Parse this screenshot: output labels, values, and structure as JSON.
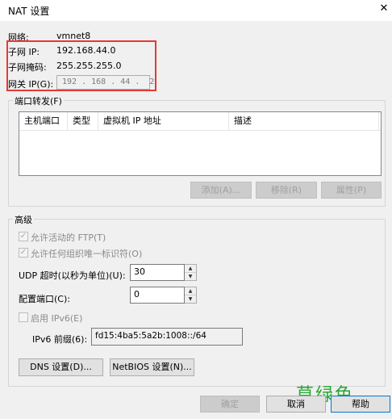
{
  "window": {
    "title": "NAT 设置",
    "close_glyph": "✕"
  },
  "network": {
    "network_label": "网络:",
    "network_value": "vmnet8",
    "subnet_ip_label": "子网 IP:",
    "subnet_ip_value": "192.168.44.0",
    "subnet_mask_label": "子网掩码:",
    "subnet_mask_value": "255.255.255.0",
    "gateway_label": "网关 IP(G):",
    "gateway_value": "192 . 168 . 44 .  2"
  },
  "port_forwarding": {
    "title": "端口转发(F)",
    "columns": [
      "主机端口",
      "类型",
      "虚拟机 IP 地址",
      "描述"
    ],
    "rows": [],
    "add_label": "添加(A)...",
    "remove_label": "移除(R)",
    "properties_label": "属性(P)"
  },
  "advanced": {
    "title": "高级",
    "allow_ftp_label": "允许活动的 FTP(T)",
    "allow_ftp_checked": true,
    "allow_oui_label": "允许任何组织唯一标识符(O)",
    "allow_oui_checked": true,
    "udp_timeout_label": "UDP 超时(以秒为单位)(U):",
    "udp_timeout_value": "30",
    "config_port_label": "配置端口(C):",
    "config_port_value": "0",
    "enable_ipv6_label": "启用 IPv6(E)",
    "enable_ipv6_checked": false,
    "ipv6_prefix_label": "IPv6 前缀(6):",
    "ipv6_prefix_value": "fd15:4ba5:5a2b:1008::/64",
    "dns_button_label": "DNS 设置(D)...",
    "netbios_button_label": "NetBIOS 设置(N)..."
  },
  "footer": {
    "ok_label": "确定",
    "cancel_label": "取消",
    "help_label": "帮助"
  },
  "watermark": {
    "text": "草绿色",
    "color": "#26a834"
  },
  "colors": {
    "highlight_border": "#e53935",
    "default_button_border": "#0078d7"
  }
}
